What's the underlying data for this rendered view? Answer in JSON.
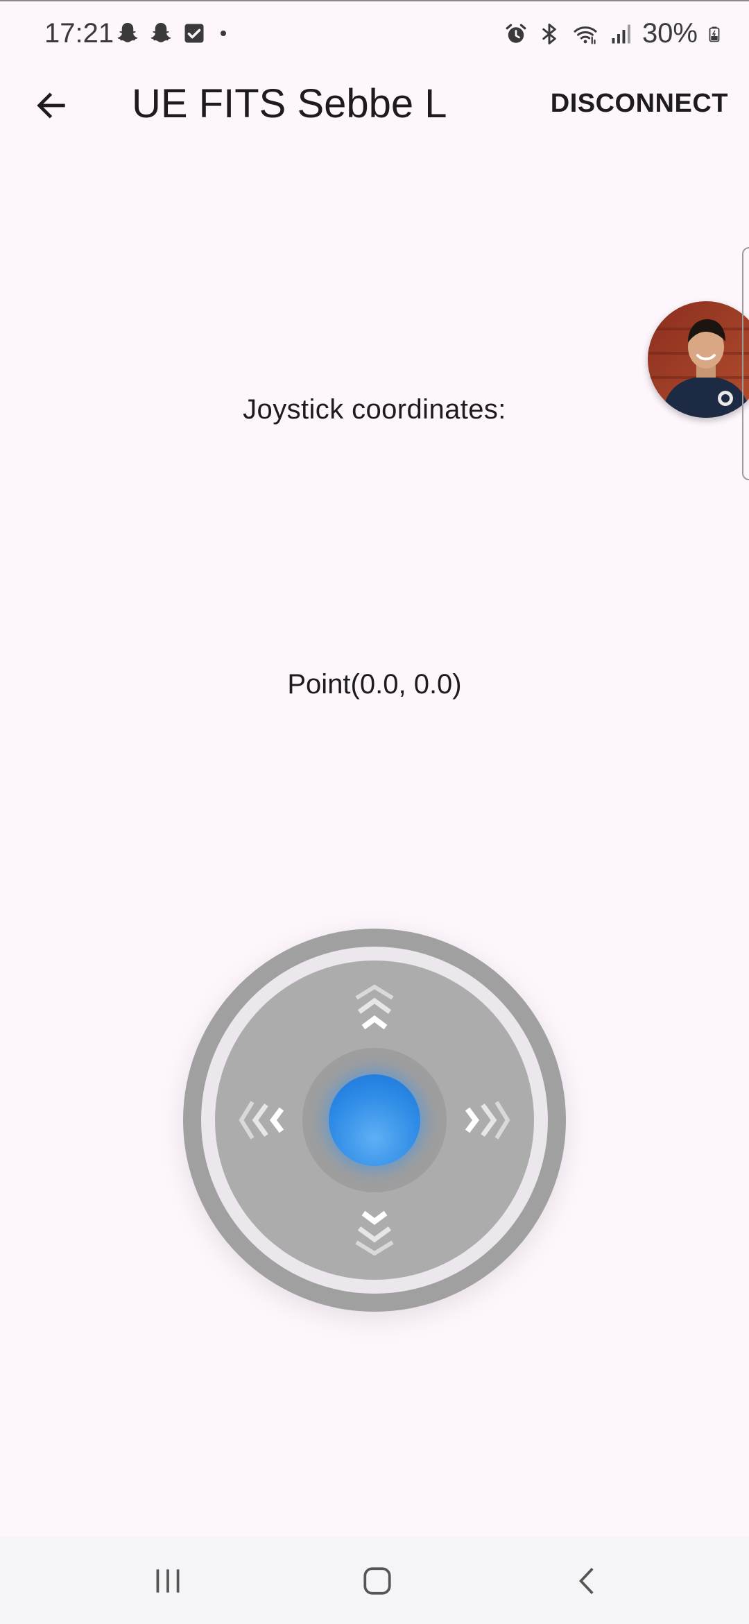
{
  "status_bar": {
    "time": "17:21",
    "battery_percent": "30%",
    "left_icons": [
      "snapchat-icon",
      "snapchat-icon",
      "checkbox-icon",
      "dot-icon"
    ],
    "right_icons": [
      "alarm-icon",
      "bluetooth-icon",
      "wifi-icon",
      "signal-icon",
      "battery-icon"
    ]
  },
  "app_bar": {
    "title": "UE FITS Sebbe L",
    "back_icon": "arrow-left-icon",
    "disconnect_label": "DISCONNECT"
  },
  "main": {
    "coords_label": "Joystick coordinates:",
    "coords_value": "Point(0.0, 0.0)"
  },
  "joystick": {
    "knob_color": "#2f8ce6",
    "base_color": "#acacac",
    "ring_color": "#a0a0a0",
    "arrows": [
      "up-arrows-icon",
      "down-arrows-icon",
      "left-arrows-icon",
      "right-arrows-icon"
    ]
  },
  "nav_bar": {
    "buttons": [
      "recent-apps-icon",
      "home-icon",
      "back-icon"
    ]
  },
  "colors": {
    "background": "#fdf7fd",
    "text": "#1d1b20",
    "accent": "#2f8ce6"
  }
}
